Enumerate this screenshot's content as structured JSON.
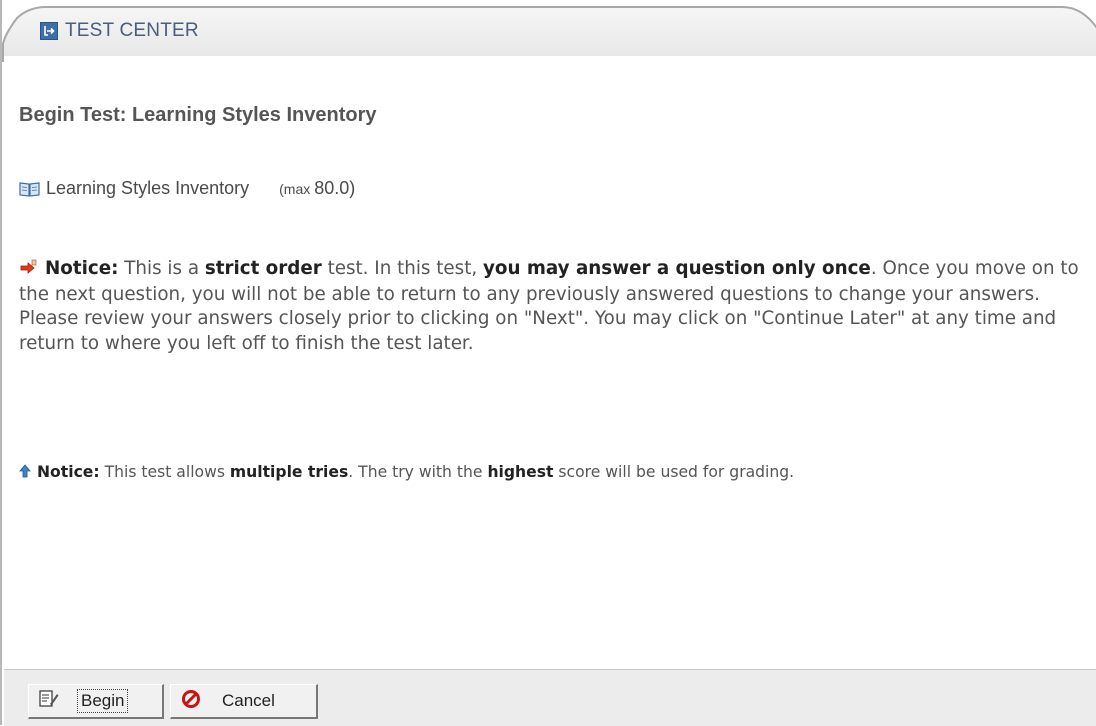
{
  "panel": {
    "title": "TEST CENTER",
    "title_icon": "export-arrow-icon"
  },
  "page": {
    "heading": "Begin Test: Learning Styles Inventory",
    "test_name": "Learning Styles Inventory",
    "test_icon": "book-icon",
    "max_label": "(max",
    "max_value": "80.0)"
  },
  "notice_strict": {
    "icon": "hand-pointer-icon",
    "label": "Notice:",
    "text1": " This is a ",
    "bold1": "strict order",
    "text2": " test. In this test, ",
    "bold2": "you may answer a question only once",
    "text3": ". Once you move on to the next question, you will not be able to return to any previously answered questions to change your answers. Please review your answers closely prior to clicking on \"Next\". You may click on \"Continue Later\" at any time and return to where you left off to finish the test later."
  },
  "notice_tries": {
    "icon": "up-arrow-icon",
    "label": "Notice:",
    "text1": " This test allows ",
    "bold1": "multiple tries",
    "text2": ". The try with the ",
    "bold2": "highest",
    "text3": " score will be used for grading."
  },
  "footer": {
    "begin_label": "Begin",
    "begin_icon": "edit-document-icon",
    "cancel_label": "Cancel",
    "cancel_icon": "cancel-circle-icon"
  },
  "colors": {
    "tab_text": "#4a5d7e",
    "footer_bg": "#ececec",
    "cancel_red": "#cc1111"
  }
}
